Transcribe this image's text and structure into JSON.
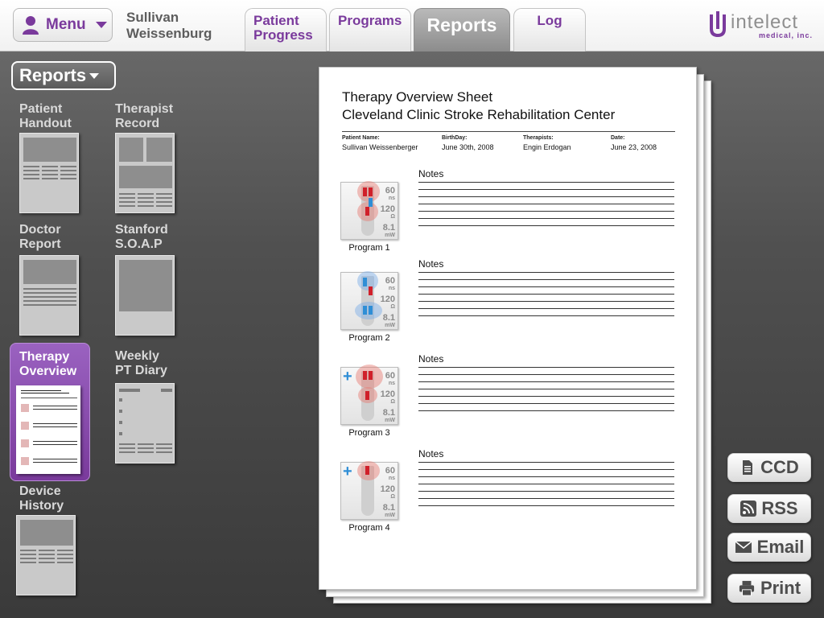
{
  "header": {
    "menu_label": "Menu",
    "patient_first": "Sullivan",
    "patient_last": "Weissenburg",
    "tabs": [
      {
        "line1": "Patient",
        "line2": "Progress"
      },
      {
        "line1": "Programs",
        "line2": ""
      },
      {
        "line1": "Reports",
        "line2": ""
      },
      {
        "line1": "Log",
        "line2": ""
      }
    ],
    "logo_text": "intelect",
    "logo_sub": "medical, inc."
  },
  "sidebar": {
    "dropdown_label": "Reports",
    "reports": [
      {
        "line1": "Patient",
        "line2": "Handout"
      },
      {
        "line1": "Therapist",
        "line2": "Record"
      },
      {
        "line1": "Doctor",
        "line2": "Report"
      },
      {
        "line1": "Stanford",
        "line2": "S.O.A.P"
      },
      {
        "line1": "Therapy",
        "line2": "Overview"
      },
      {
        "line1": "Weekly",
        "line2": "PT Diary"
      },
      {
        "line1": "Device",
        "line2": "History"
      }
    ],
    "selected": "Therapy Overview"
  },
  "document": {
    "title_line1": "Therapy Overview Sheet",
    "title_line2": "Cleveland Clinic Stroke Rehabilitation Center",
    "fields": [
      {
        "label": "Patient Name:",
        "value": "Sullivan Weissenberger"
      },
      {
        "label": "BirthDay:",
        "value": "June 30th, 2008"
      },
      {
        "label": "Therapists:",
        "value": "Engin Erdogan"
      },
      {
        "label": "Date:",
        "value": "June 23, 2008"
      }
    ],
    "notes_label": "Notes",
    "programs": [
      {
        "label": "Program 1",
        "pw": "60",
        "pw_unit": "ns",
        "imp": "120",
        "imp_unit": "Ω",
        "pwr": "8.1",
        "pwr_unit": "mW"
      },
      {
        "label": "Program 2",
        "pw": "60",
        "pw_unit": "ns",
        "imp": "120",
        "imp_unit": "Ω",
        "pwr": "8.1",
        "pwr_unit": "mW"
      },
      {
        "label": "Program 3",
        "pw": "60",
        "pw_unit": "ns",
        "imp": "120",
        "imp_unit": "Ω",
        "pwr": "8.1",
        "pwr_unit": "mW"
      },
      {
        "label": "Program 4",
        "pw": "60",
        "pw_unit": "ns",
        "imp": "120",
        "imp_unit": "Ω",
        "pwr": "8.1",
        "pwr_unit": "mW"
      }
    ]
  },
  "actions": {
    "ccd": "CCD",
    "rss": "RSS",
    "email": "Email",
    "print": "Print"
  },
  "colors": {
    "accent": "#7a3a9c",
    "tab_active": "#9a9a9a",
    "background": "#4a4a4a"
  },
  "icons": {
    "menu": "user-icon",
    "ccd": "document-icon",
    "rss": "rss-icon",
    "email": "envelope-icon",
    "print": "printer-icon"
  }
}
